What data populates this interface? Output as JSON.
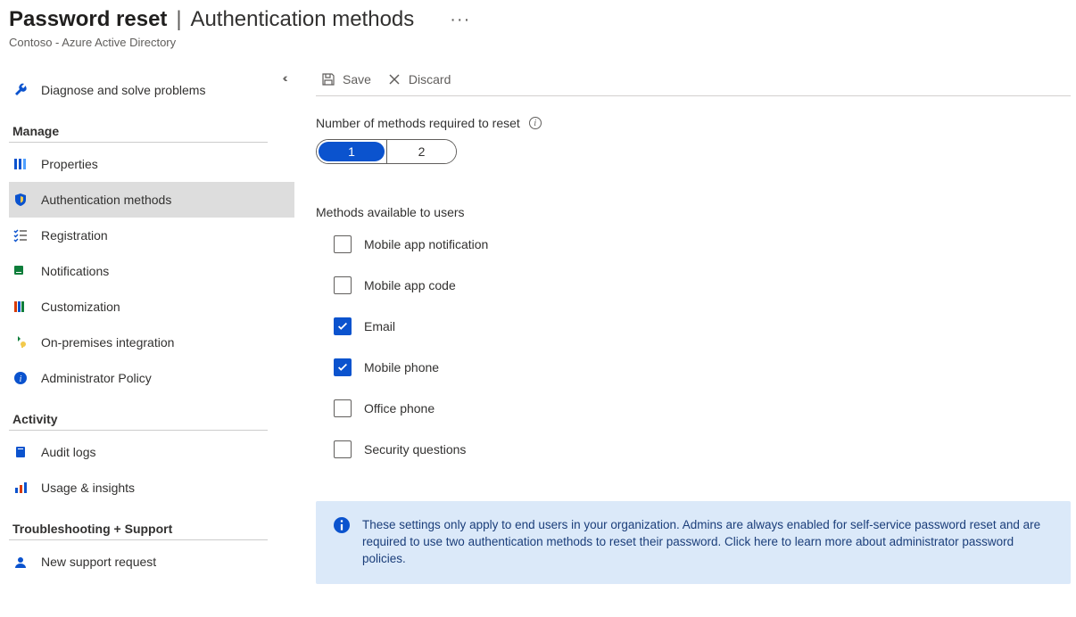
{
  "header": {
    "title": "Password reset",
    "subtitle": "Authentication methods",
    "breadcrumb": "Contoso - Azure Active Directory"
  },
  "sidebar": {
    "top_item": {
      "label": "Diagnose and solve problems"
    },
    "groups": [
      {
        "label": "Manage",
        "items": [
          {
            "key": "properties",
            "label": "Properties",
            "icon": "props",
            "active": false
          },
          {
            "key": "auth-methods",
            "label": "Authentication methods",
            "icon": "shield",
            "active": true
          },
          {
            "key": "registration",
            "label": "Registration",
            "icon": "checklist",
            "active": false
          },
          {
            "key": "notifications",
            "label": "Notifications",
            "icon": "bell",
            "active": false
          },
          {
            "key": "customization",
            "label": "Customization",
            "icon": "palette",
            "active": false
          },
          {
            "key": "onprem",
            "label": "On-premises integration",
            "icon": "key",
            "active": false
          },
          {
            "key": "admin-policy",
            "label": "Administrator Policy",
            "icon": "info",
            "active": false
          }
        ]
      },
      {
        "label": "Activity",
        "items": [
          {
            "key": "audit-logs",
            "label": "Audit logs",
            "icon": "book",
            "active": false
          },
          {
            "key": "usage",
            "label": "Usage & insights",
            "icon": "chart",
            "active": false
          }
        ]
      },
      {
        "label": "Troubleshooting + Support",
        "items": [
          {
            "key": "support",
            "label": "New support request",
            "icon": "person",
            "active": false
          }
        ]
      }
    ]
  },
  "toolbar": {
    "save_label": "Save",
    "discard_label": "Discard"
  },
  "number_methods": {
    "label": "Number of methods required to reset",
    "options": [
      "1",
      "2"
    ],
    "selected": "1"
  },
  "methods": {
    "label": "Methods available to users",
    "items": [
      {
        "key": "mobile-notification",
        "label": "Mobile app notification",
        "checked": false
      },
      {
        "key": "mobile-code",
        "label": "Mobile app code",
        "checked": false
      },
      {
        "key": "email",
        "label": "Email",
        "checked": true
      },
      {
        "key": "mobile-phone",
        "label": "Mobile phone",
        "checked": true
      },
      {
        "key": "office-phone",
        "label": "Office phone",
        "checked": false
      },
      {
        "key": "security-questions",
        "label": "Security questions",
        "checked": false
      }
    ]
  },
  "banner": {
    "text": "These settings only apply to end users in your organization. Admins are always enabled for self-service password reset and are required to use two authentication methods to reset their password. Click here to learn more about administrator password policies."
  }
}
